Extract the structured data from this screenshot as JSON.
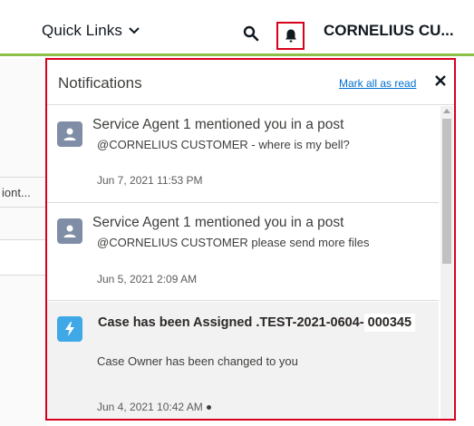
{
  "header": {
    "quick_links": "Quick Links",
    "user_name": "CORNELIUS CU..."
  },
  "background": {
    "truncated_text": "iont..."
  },
  "notifications": {
    "title": "Notifications",
    "mark_all_read": "Mark all as read",
    "items": [
      {
        "title": "Service Agent 1 mentioned you in a post",
        "body": "@CORNELIUS CUSTOMER - where is my bell?",
        "time": "Jun 7, 2021 11:53 PM",
        "icon": "user-icon"
      },
      {
        "title": "Service Agent 1 mentioned you in a post",
        "body": "@CORNELIUS CUSTOMER  please send more files",
        "time": "Jun 5, 2021 2:09 AM",
        "icon": "user-icon"
      },
      {
        "title_prefix": "Case has been Assigned .TEST-2021-0604-",
        "title_suffix": "000345",
        "body": "Case Owner has been changed to you",
        "time": "Jun 4, 2021 10:42 AM",
        "icon": "lightning-icon",
        "unread": true
      }
    ]
  },
  "colors": {
    "highlight_border": "#d8001c",
    "header_accent": "#8dc049",
    "link": "#0070d2"
  }
}
